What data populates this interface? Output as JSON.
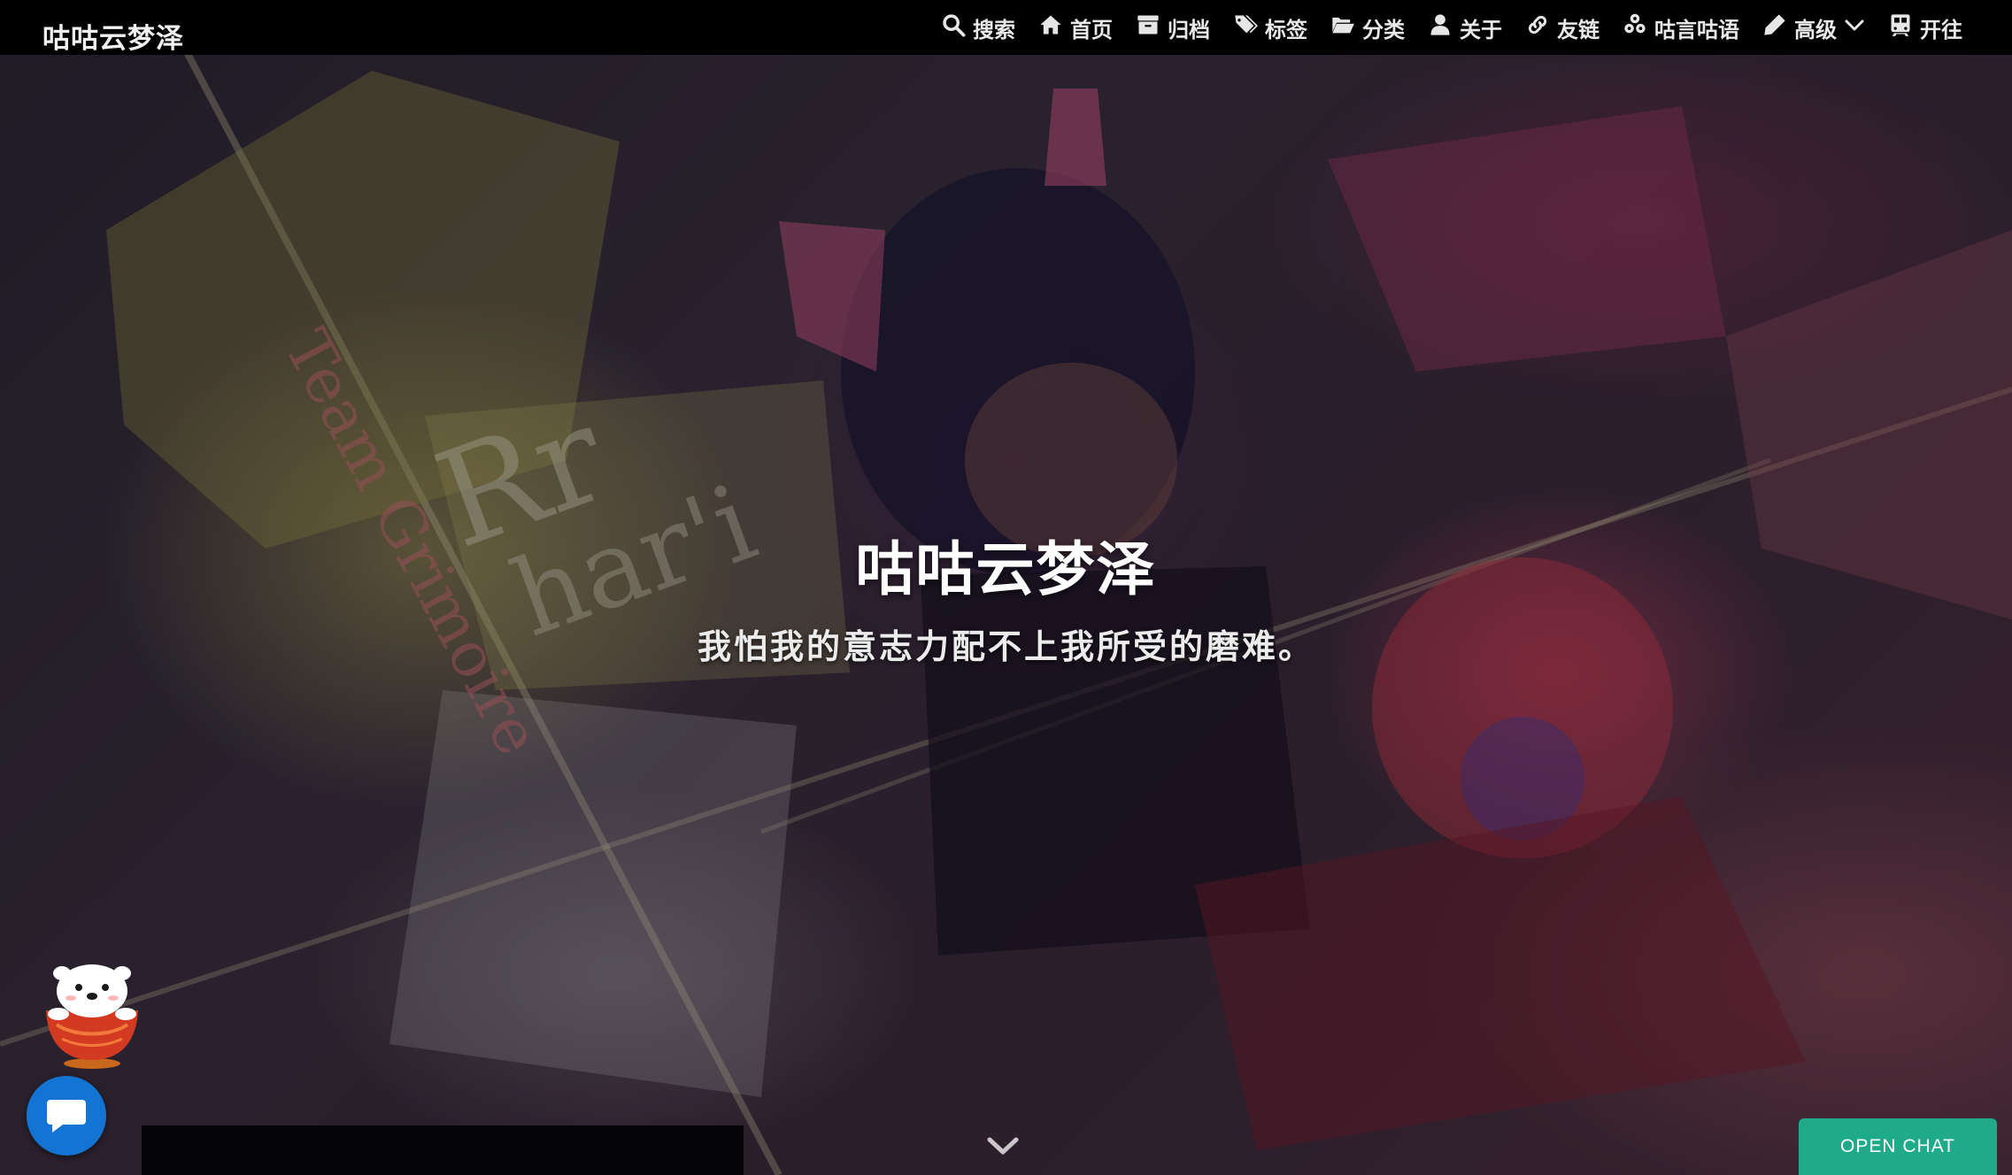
{
  "site": {
    "brand": "咕咕云梦泽"
  },
  "nav": {
    "items": [
      {
        "label": "搜索",
        "icon": "search-icon"
      },
      {
        "label": "首页",
        "icon": "home-icon"
      },
      {
        "label": "归档",
        "icon": "archive-icon"
      },
      {
        "label": "标签",
        "icon": "tags-icon"
      },
      {
        "label": "分类",
        "icon": "folder-open-icon"
      },
      {
        "label": "关于",
        "icon": "user-icon"
      },
      {
        "label": "友链",
        "icon": "link-icon"
      },
      {
        "label": "咕言咕语",
        "icon": "cubes-icon"
      },
      {
        "label": "高级",
        "icon": "pencil-icon",
        "dropdown": true
      },
      {
        "label": "开往",
        "icon": "subway-icon"
      }
    ]
  },
  "hero": {
    "title": "咕咕云梦泽",
    "subtitle": "我怕我的意志力配不上我所受的磨难。",
    "scroll_icon": "chevron-down-icon"
  },
  "widgets": {
    "open_chat_label": "OPEN CHAT",
    "chat_icon": "chat-bubble-icon",
    "chat_color": "#1474d4",
    "open_chat_color": "#1faa8a"
  }
}
